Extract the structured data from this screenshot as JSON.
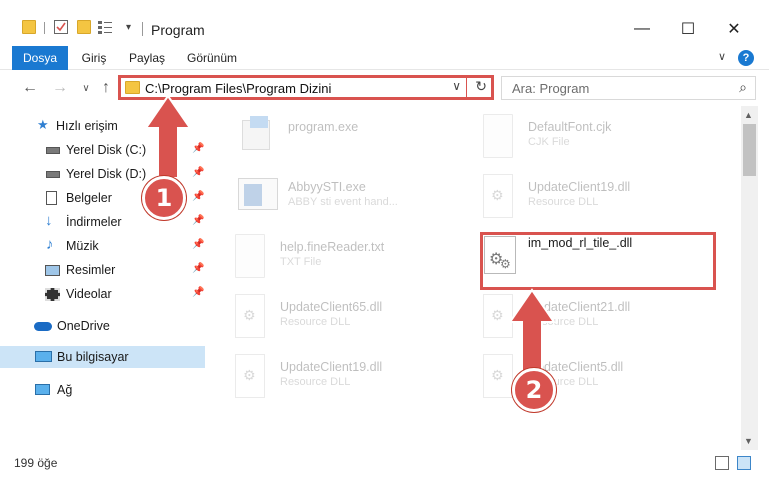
{
  "window": {
    "title": "Program",
    "minimize": "—",
    "maximize": "☐",
    "close": "✕"
  },
  "ribbon": {
    "tabs": [
      {
        "label": "Dosya",
        "active": true
      },
      {
        "label": "Giriş",
        "active": false
      },
      {
        "label": "Paylaş",
        "active": false
      },
      {
        "label": "Görünüm",
        "active": false
      }
    ],
    "help": "?"
  },
  "address": {
    "path": "C:\\Program Files\\Program Dizini"
  },
  "search": {
    "placeholder": "Ara: Program"
  },
  "sidebar": {
    "items": [
      {
        "label": "Hızlı erişim",
        "icon": "star-icon"
      },
      {
        "label": "Yerel Disk (C:)",
        "icon": "drive-icon"
      },
      {
        "label": "Yerel Disk (D:)",
        "icon": "drive-icon"
      },
      {
        "label": "Belgeler",
        "icon": "documents-icon"
      },
      {
        "label": "İndirmeler",
        "icon": "download-icon"
      },
      {
        "label": "Müzik",
        "icon": "music-icon"
      },
      {
        "label": "Resimler",
        "icon": "pictures-icon"
      },
      {
        "label": "Videolar",
        "icon": "videos-icon"
      },
      {
        "label": "OneDrive",
        "icon": "cloud-icon"
      },
      {
        "label": "Bu bilgisayar",
        "icon": "computer-icon",
        "selected": true
      },
      {
        "label": "Ağ",
        "icon": "network-icon"
      }
    ]
  },
  "files": [
    {
      "name": "program.exe",
      "type": ""
    },
    {
      "name": "DefaultFont.cjk",
      "type": "CJK File"
    },
    {
      "name": "AbbyySTI.exe",
      "type": "ABBY sti event hand..."
    },
    {
      "name": "UpdateClient19.dll",
      "type": "Resource DLL"
    },
    {
      "name": "help.fineReader.txt",
      "type": "TXT File"
    },
    {
      "name": "im_mod_rl_tile_.dll",
      "type": ""
    },
    {
      "name": "UpdateClient65.dll",
      "type": "Resource DLL"
    },
    {
      "name": "UpdateClient21.dll",
      "type": "Resource DLL"
    },
    {
      "name": "UpdateClient19.dll",
      "type": "Resource DLL"
    },
    {
      "name": "UpdateClient5.dll",
      "type": "Resource DLL"
    }
  ],
  "status": {
    "count": "199 öğe"
  },
  "annotations": {
    "step1": "1",
    "step2": "2",
    "color": "#d9534f"
  }
}
